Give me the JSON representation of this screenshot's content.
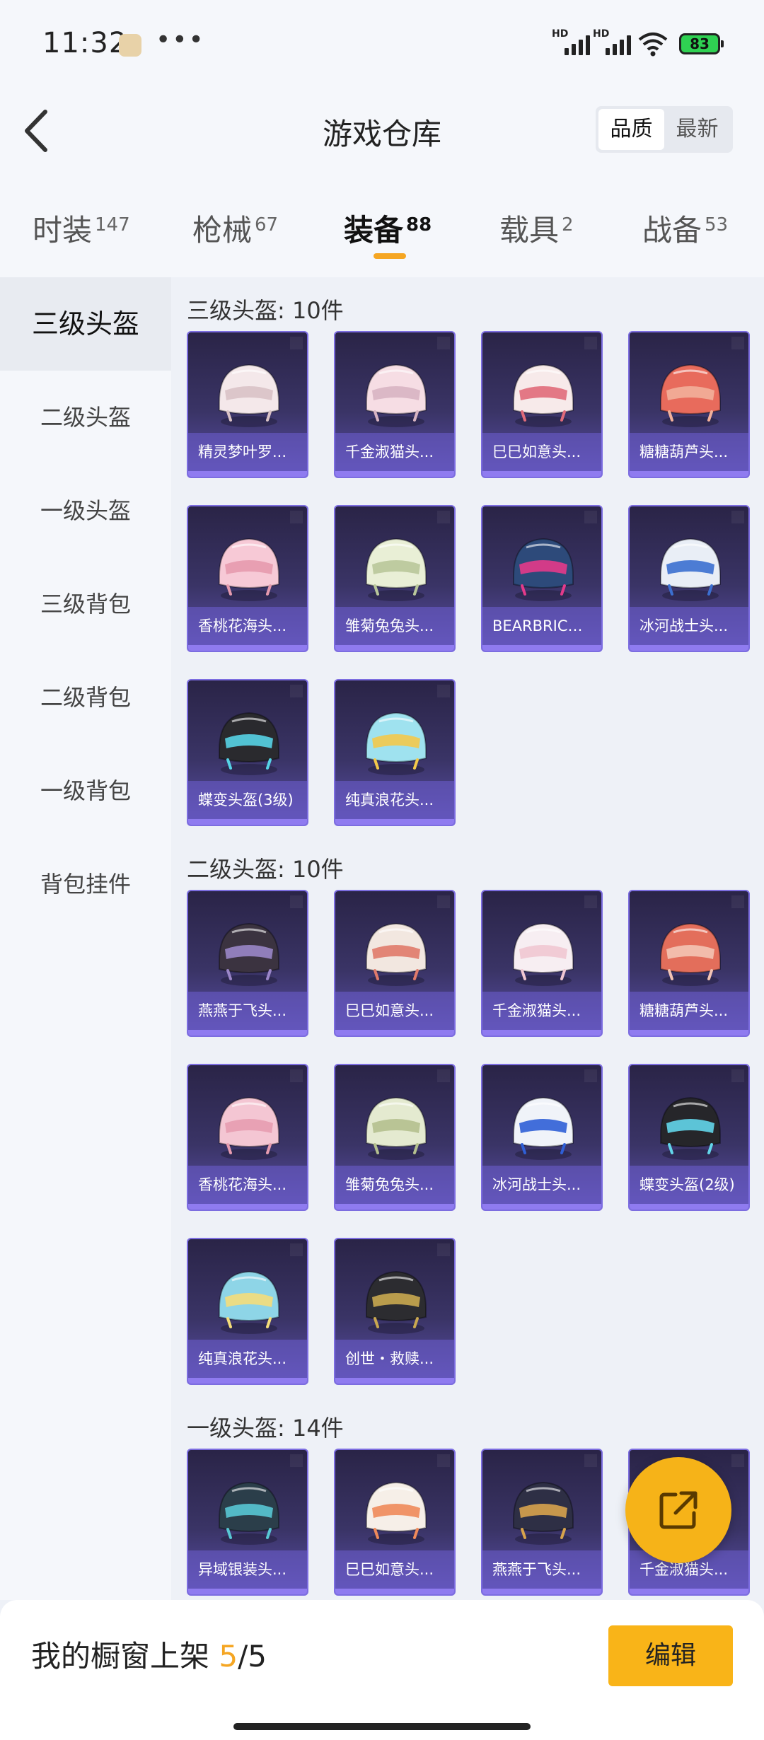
{
  "status": {
    "time": "11:32",
    "more": "•••",
    "hd": "HD",
    "battery": "83"
  },
  "header": {
    "title": "游戏仓库",
    "sort": [
      "品质",
      "最新"
    ]
  },
  "tabs": [
    {
      "label": "时装",
      "count": "147"
    },
    {
      "label": "枪械",
      "count": "67"
    },
    {
      "label": "装备",
      "count": "88"
    },
    {
      "label": "载具",
      "count": "2"
    },
    {
      "label": "战备",
      "count": "53"
    }
  ],
  "sidebar": [
    "三级头盔",
    "二级头盔",
    "一级头盔",
    "三级背包",
    "二级背包",
    "一级背包",
    "背包挂件"
  ],
  "sections": [
    {
      "title": "三级头盔: 10件",
      "items": [
        "精灵梦叶罗...",
        "千金淑猫头...",
        "巳巳如意头...",
        "糖糖葫芦头...",
        "香桃花海头...",
        "雏菊兔兔头...",
        "BEARBRICK...",
        "冰河战士头...",
        "蝶变头盔(3级)",
        "纯真浪花头..."
      ]
    },
    {
      "title": "二级头盔: 10件",
      "items": [
        "燕燕于飞头...",
        "巳巳如意头...",
        "千金淑猫头...",
        "糖糖葫芦头...",
        "香桃花海头...",
        "雏菊兔兔头...",
        "冰河战士头...",
        "蝶变头盔(2级)",
        "纯真浪花头...",
        "创世・救赎..."
      ]
    },
    {
      "title": "一级头盔: 14件",
      "items": [
        "异域银装头...",
        "巳巳如意头...",
        "燕燕于飞头...",
        "千金淑猫头..."
      ]
    }
  ],
  "bottom": {
    "label": "我的橱窗上架 ",
    "count": "5",
    "total": "/5",
    "edit": "编辑"
  },
  "colors": {
    "accent": "#f5a623",
    "card_border": "#7c6de0",
    "card_bg": "#3a3466"
  }
}
